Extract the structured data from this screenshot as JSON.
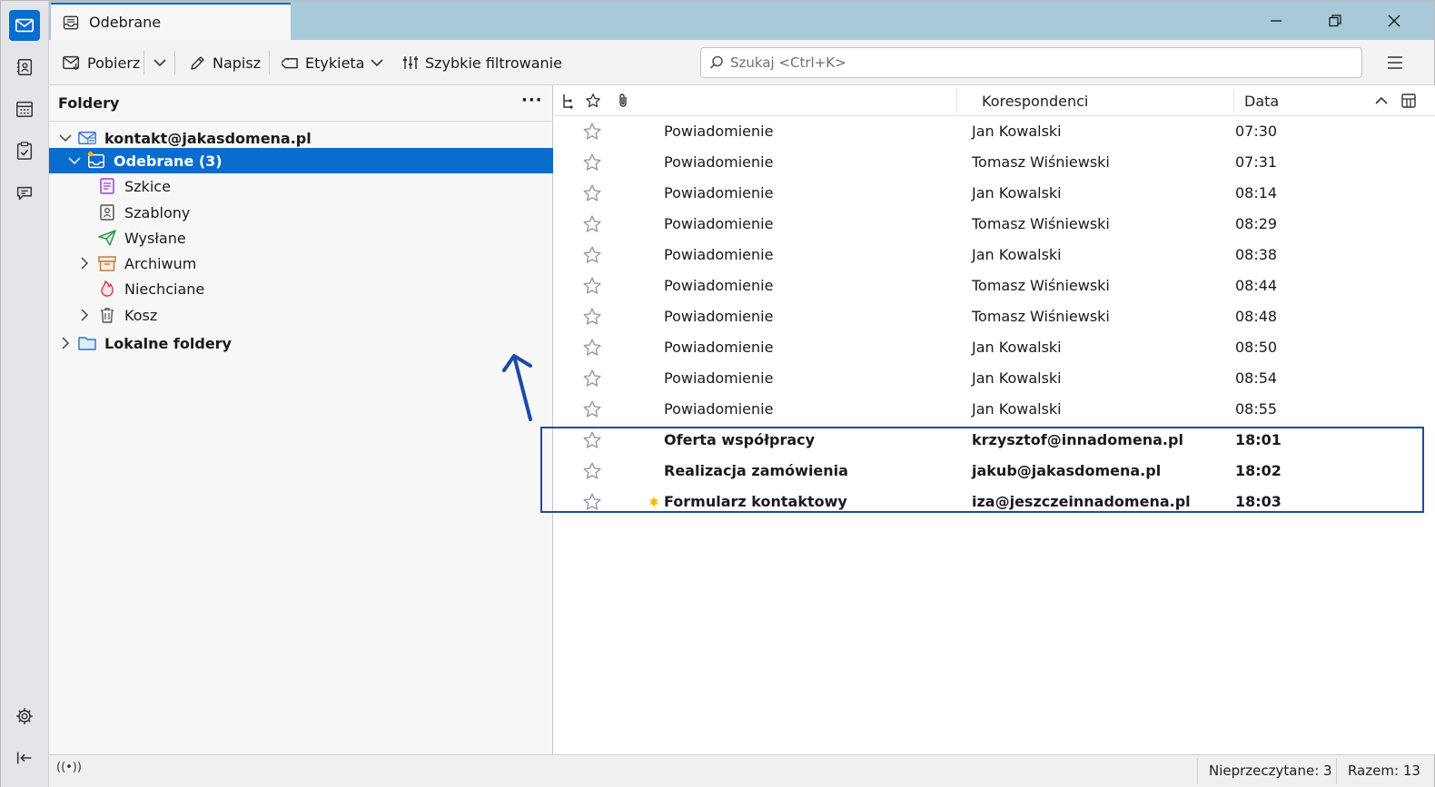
{
  "window": {
    "tab_title": "Odebrane",
    "minimize_glyph": "—",
    "maximize_glyph": "❐",
    "close_glyph": "✕"
  },
  "spaces": [
    {
      "name": "mail-icon",
      "active": true
    },
    {
      "name": "address-book-icon",
      "active": false
    },
    {
      "name": "calendar-icon",
      "active": false
    },
    {
      "name": "tasks-icon",
      "active": false
    },
    {
      "name": "chat-icon",
      "active": false
    },
    {
      "name": "settings-icon",
      "active": false
    },
    {
      "name": "collapse-icon",
      "active": false
    }
  ],
  "toolbar": {
    "get_messages": "Pobierz",
    "write": "Napisz",
    "tag": "Etykieta",
    "quick_filter": "Szybkie filtrowanie",
    "search_placeholder": "Szukaj <Ctrl+K>"
  },
  "folders": {
    "title": "Foldery",
    "more": "···",
    "account": "kontakt@jakasdomena.pl",
    "inbox": "Odebrane (3)",
    "drafts": "Szkice",
    "templates": "Szablony",
    "sent": "Wysłane",
    "archive": "Archiwum",
    "junk": "Niechciane",
    "trash": "Kosz",
    "local": "Lokalne foldery"
  },
  "message_list": {
    "columns": {
      "correspondents": "Korespondenci",
      "date": "Data"
    },
    "rows": [
      {
        "subject": "Powiadomienie",
        "correspondent": "Jan Kowalski",
        "date": "07:30",
        "unread": false,
        "new": false
      },
      {
        "subject": "Powiadomienie",
        "correspondent": "Tomasz Wiśniewski",
        "date": "07:31",
        "unread": false,
        "new": false
      },
      {
        "subject": "Powiadomienie",
        "correspondent": "Jan Kowalski",
        "date": "08:14",
        "unread": false,
        "new": false
      },
      {
        "subject": "Powiadomienie",
        "correspondent": "Tomasz Wiśniewski",
        "date": "08:29",
        "unread": false,
        "new": false
      },
      {
        "subject": "Powiadomienie",
        "correspondent": "Jan Kowalski",
        "date": "08:38",
        "unread": false,
        "new": false
      },
      {
        "subject": "Powiadomienie",
        "correspondent": "Tomasz Wiśniewski",
        "date": "08:44",
        "unread": false,
        "new": false
      },
      {
        "subject": "Powiadomienie",
        "correspondent": "Tomasz Wiśniewski",
        "date": "08:48",
        "unread": false,
        "new": false
      },
      {
        "subject": "Powiadomienie",
        "correspondent": "Jan Kowalski",
        "date": "08:50",
        "unread": false,
        "new": false
      },
      {
        "subject": "Powiadomienie",
        "correspondent": "Jan Kowalski",
        "date": "08:54",
        "unread": false,
        "new": false
      },
      {
        "subject": "Powiadomienie",
        "correspondent": "Jan Kowalski",
        "date": "08:55",
        "unread": false,
        "new": false
      },
      {
        "subject": "Oferta współpracy",
        "correspondent": "krzysztof@innadomena.pl",
        "date": "18:01",
        "unread": true,
        "new": false
      },
      {
        "subject": "Realizacja zamówienia",
        "correspondent": "jakub@jakasdomena.pl",
        "date": "18:02",
        "unread": true,
        "new": false
      },
      {
        "subject": "Formularz kontaktowy",
        "correspondent": "iza@jeszczeinnadomena.pl",
        "date": "18:03",
        "unread": true,
        "new": true
      }
    ]
  },
  "status": {
    "activity": "((•))",
    "unread": "Nieprzeczytane: 3",
    "total": "Razem: 13"
  },
  "colors": {
    "accent": "#0a6ccd",
    "titlebar": "#a7c9d8",
    "annotation": "#1c4aa8"
  }
}
